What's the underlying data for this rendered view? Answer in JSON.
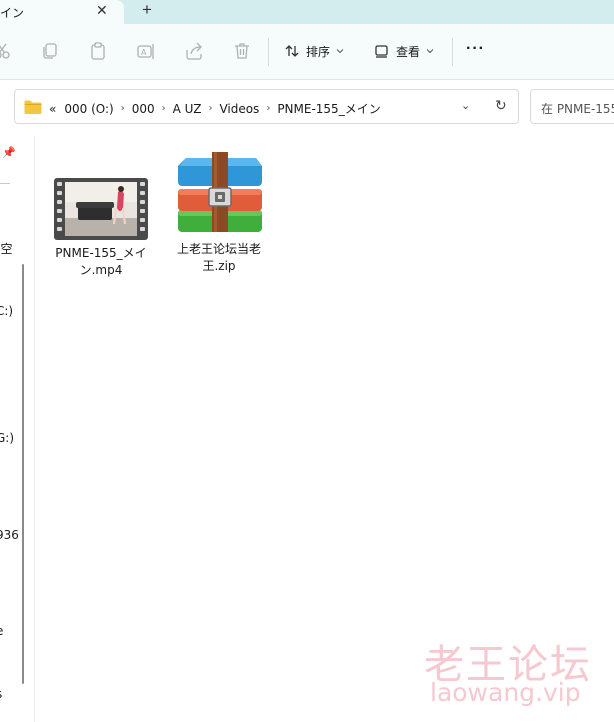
{
  "tab": {
    "title": "イン",
    "close_glyph": "✕",
    "new_tab_glyph": "+"
  },
  "toolbar": {
    "icons": [
      "cut-icon",
      "copy-icon",
      "paste-icon",
      "rename-icon",
      "share-icon",
      "delete-icon"
    ],
    "sort_label": "排序",
    "view_label": "查看",
    "more_glyph": "···"
  },
  "address": {
    "overflow": "«",
    "crumbs": [
      "000 (O:)",
      "000",
      "A UZ",
      "Videos",
      "PNME-155_メイン"
    ],
    "dropdown_glyph": "⌄",
    "refresh_glyph": "↻"
  },
  "search": {
    "placeholder": "在 PNME-155"
  },
  "nav": {
    "items": [
      "ɛ空",
      "C:)",
      "G:)",
      "936",
      "e",
      "s"
    ]
  },
  "files": [
    {
      "name": "PNME-155_メイン.mp4",
      "type": "video"
    },
    {
      "name": "上老王论坛当老王.zip",
      "type": "zip"
    }
  ],
  "watermark": {
    "chinese": "老王论坛",
    "latin": "laowang.vip"
  },
  "colors": {
    "tabstrip": "#d3ecee",
    "commandbar": "#f6fbfb",
    "folder": "#f4c542",
    "watermark": "#f6c8cf"
  }
}
